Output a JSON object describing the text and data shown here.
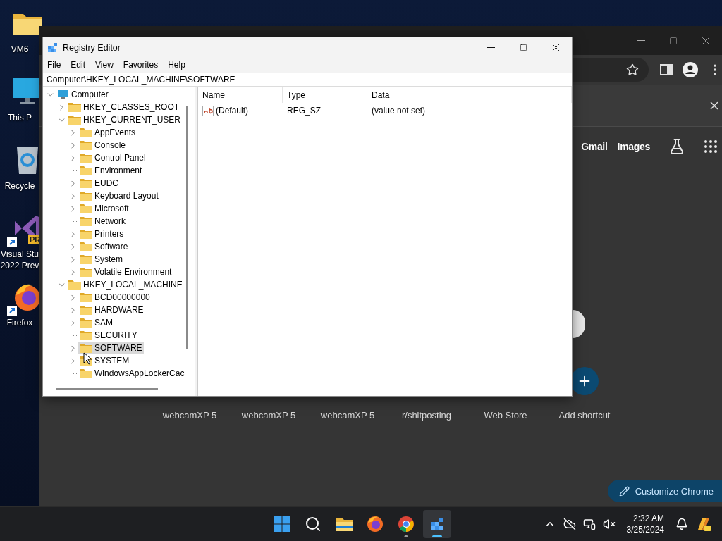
{
  "desktop_icons": [
    {
      "kind": "folder",
      "label": "VM6",
      "shortcut": false
    },
    {
      "kind": "computer",
      "label": "This P",
      "shortcut": false
    },
    {
      "kind": "recycle",
      "label": "Recycle",
      "shortcut": false
    },
    {
      "kind": "studio",
      "label": "Visual Stu\n2022 Prev",
      "badge": "PR",
      "shortcut": true
    },
    {
      "kind": "browser",
      "label": "Firefox",
      "shortcut": true
    }
  ],
  "browser": {
    "header_links": [
      {
        "label": "Gmail"
      },
      {
        "label": "Images"
      }
    ],
    "shortcuts": [
      {
        "kind": "site",
        "label": "webcamXP 5"
      },
      {
        "kind": "site",
        "label": "webcamXP 5"
      },
      {
        "kind": "site",
        "label": "webcamXP 5"
      },
      {
        "kind": "site",
        "label": "r/shitposting"
      },
      {
        "kind": "site",
        "label": "Web Store"
      },
      {
        "kind": "add",
        "label": "Add shortcut"
      }
    ],
    "customize_button": "Customize Chrome"
  },
  "registry": {
    "title": "Registry Editor",
    "menu": [
      "File",
      "Edit",
      "View",
      "Favorites",
      "Help"
    ],
    "address": "Computer\\HKEY_LOCAL_MACHINE\\SOFTWARE",
    "tree": [
      {
        "label": "Computer",
        "kind": "computer",
        "expandable": true,
        "expanded": true,
        "selected": false,
        "children": [
          {
            "label": "HKEY_CLASSES_ROOT",
            "kind": "folder",
            "expandable": true,
            "selected": false
          },
          {
            "label": "HKEY_CURRENT_USER",
            "kind": "folder",
            "expandable": true,
            "expanded": true,
            "selected": false,
            "children": [
              {
                "label": "AppEvents",
                "kind": "folder",
                "expandable": true,
                "selected": false
              },
              {
                "label": "Console",
                "kind": "folder",
                "expandable": true,
                "selected": false
              },
              {
                "label": "Control Panel",
                "kind": "folder",
                "expandable": true,
                "selected": false
              },
              {
                "label": "Environment",
                "kind": "folder",
                "expandable": false,
                "selected": false
              },
              {
                "label": "EUDC",
                "kind": "folder",
                "expandable": true,
                "selected": false
              },
              {
                "label": "Keyboard Layout",
                "kind": "folder",
                "expandable": true,
                "selected": false
              },
              {
                "label": "Microsoft",
                "kind": "folder",
                "expandable": true,
                "selected": false
              },
              {
                "label": "Network",
                "kind": "folder",
                "expandable": false,
                "selected": false
              },
              {
                "label": "Printers",
                "kind": "folder",
                "expandable": true,
                "selected": false
              },
              {
                "label": "Software",
                "kind": "folder",
                "expandable": true,
                "selected": false
              },
              {
                "label": "System",
                "kind": "folder",
                "expandable": true,
                "selected": false
              },
              {
                "label": "Volatile Environment",
                "kind": "folder",
                "expandable": true,
                "selected": false
              }
            ]
          },
          {
            "label": "HKEY_LOCAL_MACHINE",
            "kind": "folder",
            "expandable": true,
            "expanded": true,
            "selected": false,
            "children": [
              {
                "label": "BCD00000000",
                "kind": "folder",
                "expandable": true,
                "selected": false
              },
              {
                "label": "HARDWARE",
                "kind": "folder",
                "expandable": true,
                "selected": false
              },
              {
                "label": "SAM",
                "kind": "folder",
                "expandable": true,
                "selected": false
              },
              {
                "label": "SECURITY",
                "kind": "folder",
                "expandable": false,
                "selected": false
              },
              {
                "label": "SOFTWARE",
                "kind": "folder",
                "expandable": true,
                "selected": true
              },
              {
                "label": "SYSTEM",
                "kind": "folder",
                "expandable": true,
                "selected": false
              },
              {
                "label": "WindowsAppLockerCac",
                "kind": "folder",
                "expandable": false,
                "selected": false
              }
            ]
          }
        ]
      }
    ],
    "columns": [
      "Name",
      "Type",
      "Data"
    ],
    "rows": [
      {
        "name": "(Default)",
        "type": "REG_SZ",
        "data": "(value not set)"
      }
    ]
  },
  "taskbar": {
    "apps": [
      {
        "kind": "start",
        "running": false,
        "selected": false
      },
      {
        "kind": "search",
        "running": false,
        "selected": false
      },
      {
        "kind": "explorer",
        "running": false,
        "selected": false
      },
      {
        "kind": "firefox",
        "running": false,
        "selected": false
      },
      {
        "kind": "chrome",
        "running": true,
        "selected": false
      },
      {
        "kind": "regedit",
        "running": true,
        "selected": true
      }
    ],
    "clock": {
      "time": "2:32 AM",
      "date": "3/25/2024"
    }
  }
}
